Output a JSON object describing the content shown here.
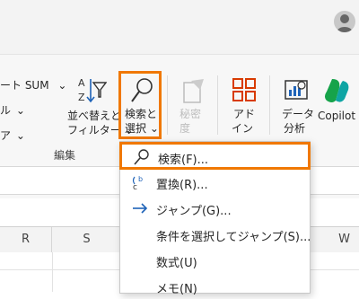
{
  "ribbon": {
    "autosum_label": "ート SUM",
    "fill_label": "ル",
    "clear_label": "ア",
    "sort_filter_label_1": "並べ替えと",
    "sort_filter_label_2": "フィルター",
    "find_select_label_1": "検索と",
    "find_select_label_2": "選択",
    "sensitivity_label_1": "秘密",
    "sensitivity_label_2": "度",
    "addin_label_1": "アド",
    "addin_label_2": "イン",
    "data_analysis_label_1": "データ",
    "data_analysis_label_2": "分析",
    "copilot_label": "Copilot",
    "group_editing": "編集"
  },
  "columns": [
    "R",
    "S",
    "W"
  ],
  "menu": {
    "items": [
      {
        "label": "検索(F)...",
        "icon": "search-icon"
      },
      {
        "label": "置換(R)...",
        "icon": "replace-icon"
      },
      {
        "label": "ジャンプ(G)...",
        "icon": "arrow-right-icon"
      },
      {
        "label": "条件を選択してジャンプ(S)...",
        "icon": ""
      },
      {
        "label": "数式(U)",
        "icon": ""
      },
      {
        "label": "メモ(N)",
        "icon": ""
      }
    ]
  },
  "colors": {
    "highlight": "#f07800",
    "copilot_green": "#16a34a",
    "addin_red": "#d83b01"
  }
}
